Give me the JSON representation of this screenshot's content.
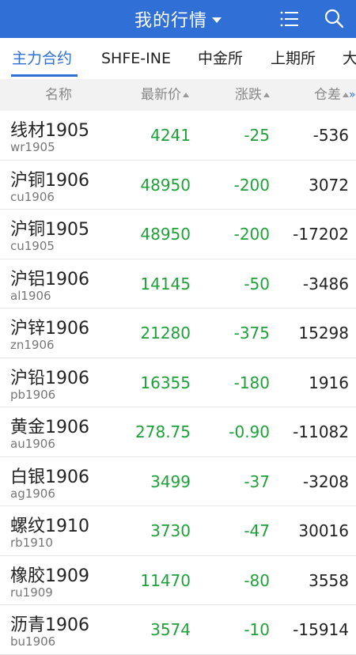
{
  "header": {
    "title": "我的行情",
    "accent_color": "#2f6fd6"
  },
  "tabs": [
    {
      "label": "主力合约",
      "active": true
    },
    {
      "label": "SHFE-INE",
      "active": false
    },
    {
      "label": "中金所",
      "active": false
    },
    {
      "label": "上期所",
      "active": false
    },
    {
      "label": "大",
      "active": false
    }
  ],
  "columns": {
    "name": "名称",
    "price": "最新价",
    "change": "涨跌",
    "oi": "仓差"
  },
  "colors": {
    "down": "#1fa13a",
    "neutral": "#222222"
  },
  "rows": [
    {
      "name": "线材1905",
      "code": "wr1905",
      "price": "4241",
      "change": "-25",
      "oi": "-536"
    },
    {
      "name": "沪铜1906",
      "code": "cu1906",
      "price": "48950",
      "change": "-200",
      "oi": "3072"
    },
    {
      "name": "沪铜1905",
      "code": "cu1905",
      "price": "48950",
      "change": "-200",
      "oi": "-17202"
    },
    {
      "name": "沪铝1906",
      "code": "al1906",
      "price": "14145",
      "change": "-50",
      "oi": "-3486"
    },
    {
      "name": "沪锌1906",
      "code": "zn1906",
      "price": "21280",
      "change": "-375",
      "oi": "15298"
    },
    {
      "name": "沪铅1906",
      "code": "pb1906",
      "price": "16355",
      "change": "-180",
      "oi": "1916"
    },
    {
      "name": "黄金1906",
      "code": "au1906",
      "price": "278.75",
      "change": "-0.90",
      "oi": "-11082"
    },
    {
      "name": "白银1906",
      "code": "ag1906",
      "price": "3499",
      "change": "-37",
      "oi": "-3208"
    },
    {
      "name": "螺纹1910",
      "code": "rb1910",
      "price": "3730",
      "change": "-47",
      "oi": "30016"
    },
    {
      "name": "橡胶1909",
      "code": "ru1909",
      "price": "11470",
      "change": "-80",
      "oi": "3558"
    },
    {
      "name": "沥青1906",
      "code": "bu1906",
      "price": "3574",
      "change": "-10",
      "oi": "-15914"
    }
  ]
}
